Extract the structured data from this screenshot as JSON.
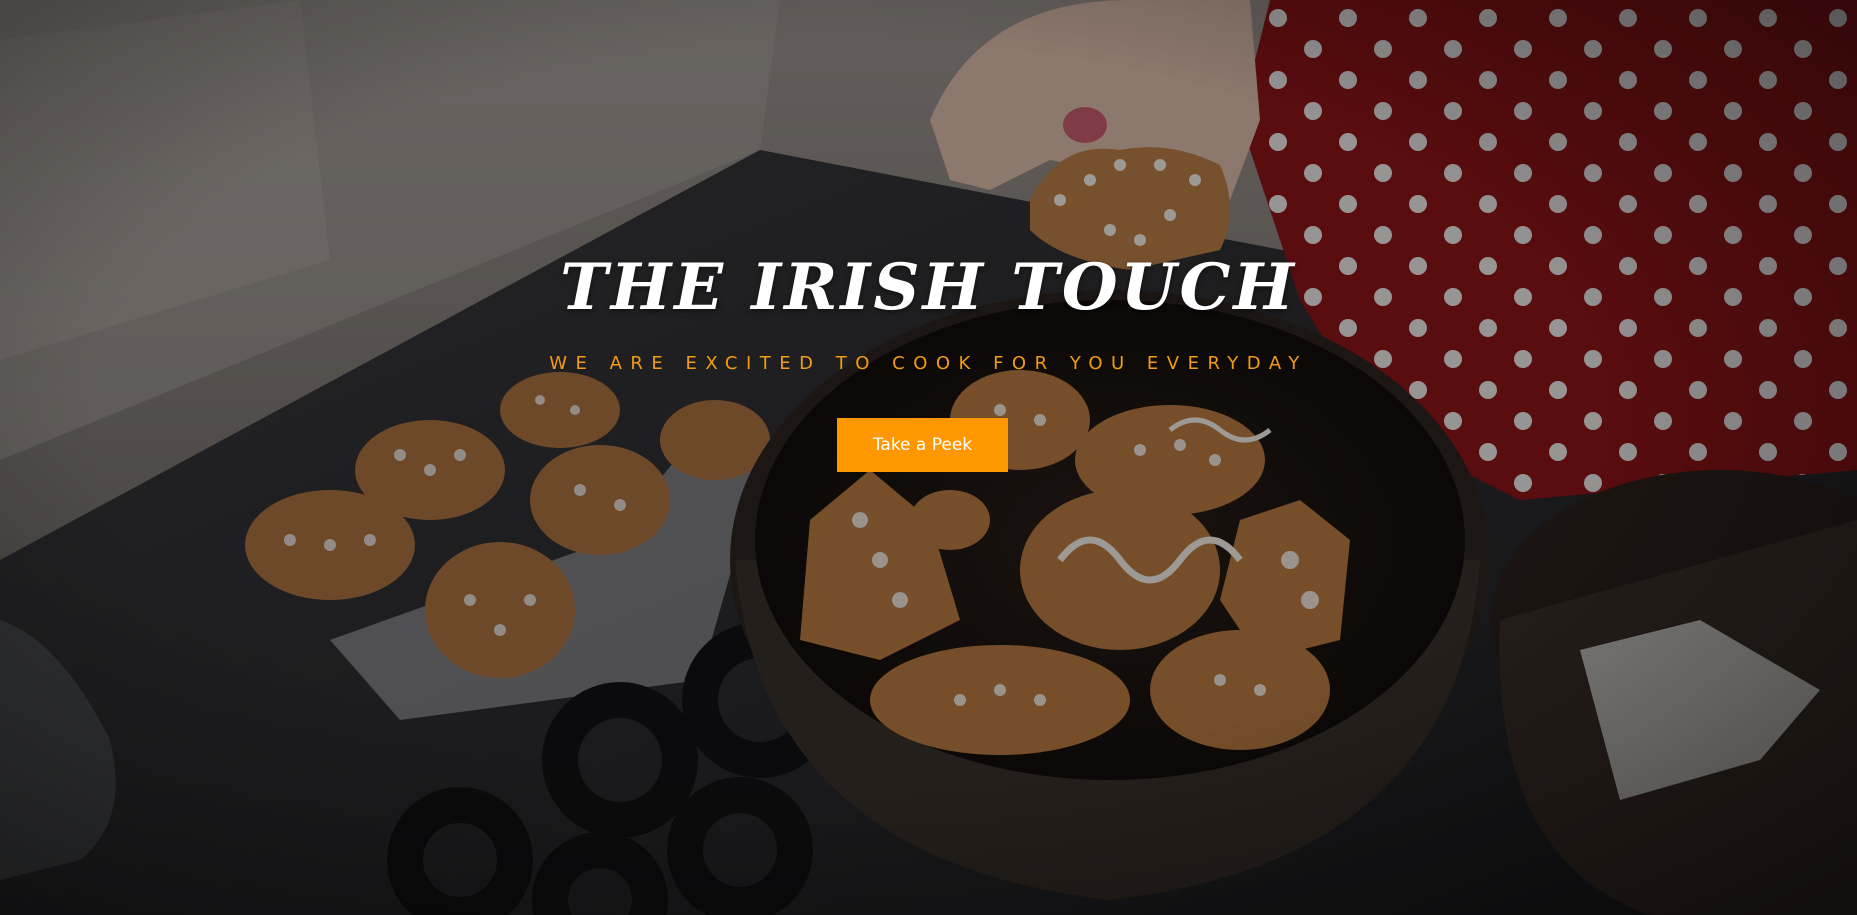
{
  "hero": {
    "title": "THE IRISH TOUCH",
    "subtitle": "WE ARE EXCITED TO COOK FOR YOU EVERYDAY",
    "cta_label": "Take a Peek",
    "cta_color": "#ff9800",
    "subtitle_color": "#f39c12",
    "background_image": "gingerbread-cookies-tin-photo"
  }
}
